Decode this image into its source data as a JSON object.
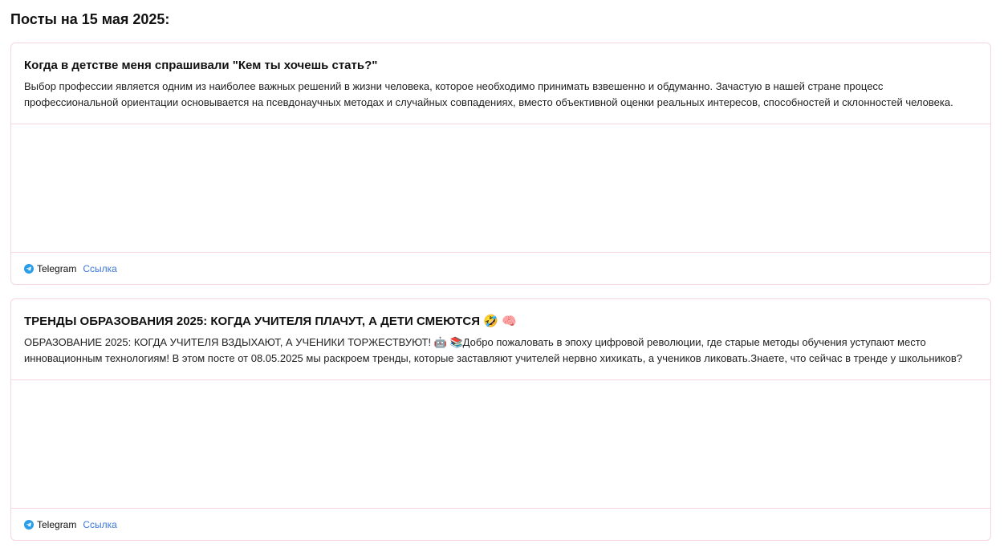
{
  "page": {
    "title": "Посты на 15 мая 2025:"
  },
  "posts": [
    {
      "title": "Когда в детстве меня спрашивали \"Кем ты хочешь стать?\"",
      "excerpt": "Выбор профессии является одним из наиболее важных решений в жизни человека, которое необходимо принимать взвешенно и обдуманно. Зачастую в нашей стране процесс профессиональной ориентации основывается на псевдонаучных методах и случайных совпадениях, вместо объективной оценки реальных интересов, способностей и склонностей человека.",
      "source": "Telegram",
      "link_label": "Ссылка",
      "source_icon": "telegram-icon"
    },
    {
      "title": "ТРЕНДЫ ОБРАЗОВАНИЯ 2025: КОГДА УЧИТЕЛЯ ПЛАЧУТ, А ДЕТИ СМЕЮТСЯ 🤣 🧠",
      "excerpt": "ОБРАЗОВАНИЕ 2025: КОГДА УЧИТЕЛЯ ВЗДЫХАЮТ, А УЧЕНИКИ ТОРЖЕСТВУЮТ! 🤖 📚Добро пожаловать в эпоху цифровой революции, где старые методы обучения уступают место инновационным технологиям! В этом посте от 08.05.2025 мы раскроем тренды, которые заставляют учителей нервно хихикать, а учеников ликовать.Знаете, что сейчас в тренде у школьников?",
      "source": "Telegram",
      "link_label": "Ссылка",
      "source_icon": "telegram-icon"
    }
  ],
  "colors": {
    "card_border": "#f5d6e0",
    "link": "#3b78d8",
    "telegram": "#2a9ee8"
  }
}
